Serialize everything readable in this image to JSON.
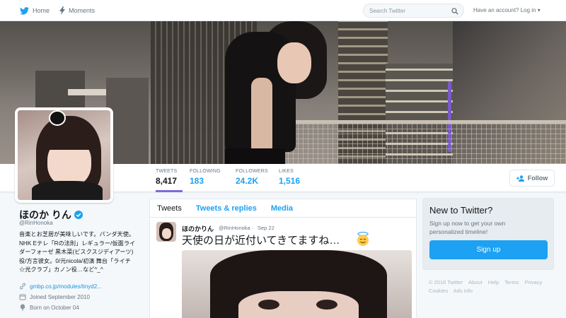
{
  "topnav": {
    "home_label": "Home",
    "moments_label": "Moments",
    "search_placeholder": "Search Twitter",
    "login_label": "Have an account? Log in",
    "icons": [
      "twitter-bird-icon",
      "bolt-icon",
      "search-icon",
      "caret-down-icon"
    ]
  },
  "profile_nav": {
    "stats": [
      {
        "label": "TWEETS",
        "value": "8,417",
        "active": true
      },
      {
        "label": "FOLLOWING",
        "value": "183"
      },
      {
        "label": "FOLLOWERS",
        "value": "24.2K"
      },
      {
        "label": "LIKES",
        "value": "1,516"
      }
    ],
    "follow_label": "Follow"
  },
  "profile": {
    "name": "ほのか りん",
    "handle": "@RinHonoka",
    "bio_lines": [
      "音楽とお芝居が美味しいです。パンダ天使。",
      "NHK Eテレ「Rの法則」レギュラー/仮面ライ",
      "ダーフォーゼ 黒木菜(ビスクスジディアーツ)",
      "役/方言彼女。0/元nicola/初演 舞台「ライチ",
      "☆光クラブ」カノン役…など^_^"
    ],
    "link": "gmbp.co.jp/modules/tinyd2...",
    "joined": "Joined September 2010",
    "born": "Born on October 04"
  },
  "timeline": {
    "tabs": [
      {
        "label": "Tweets",
        "active": true
      },
      {
        "label": "Tweets & replies"
      },
      {
        "label": "Media"
      }
    ],
    "tweet": {
      "name": "ほのかりん",
      "handle": "@RinHonoka",
      "separator": "·",
      "date": "Sep 22",
      "text": "天使の日が近付いてきてますね…"
    }
  },
  "sidebar": {
    "new_title": "New to Twitter?",
    "new_sub": "Sign up now to get your own personalized timeline!",
    "signup_label": "Sign up",
    "footer": [
      "© 2016 Twitter",
      "About",
      "Help",
      "Terms",
      "Privacy",
      "Cookies",
      "Ads info"
    ]
  },
  "colors": {
    "accent": "#1da1f2",
    "active_tab_underline": "#7c6bd6",
    "verified": "#1da1f2"
  }
}
